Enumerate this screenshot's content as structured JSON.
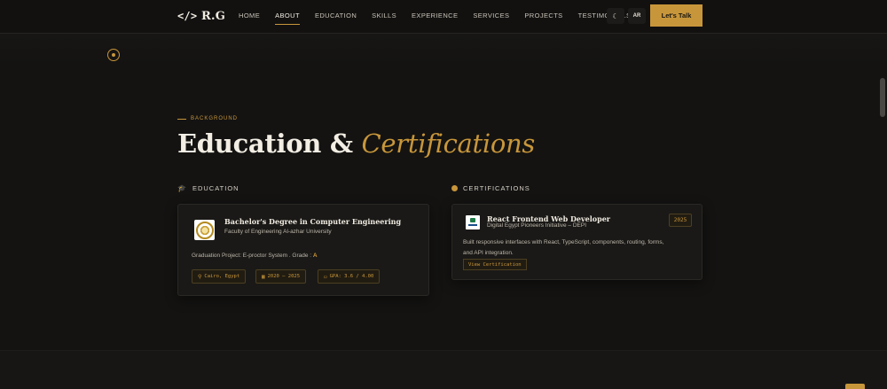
{
  "nav": {
    "logo_code": "</>",
    "logo_text": "R.G",
    "links": [
      {
        "label": "HOME",
        "active": false
      },
      {
        "label": "ABOUT",
        "active": true
      },
      {
        "label": "EDUCATION",
        "active": false
      },
      {
        "label": "SKILLS",
        "active": false
      },
      {
        "label": "EXPERIENCE",
        "active": false
      },
      {
        "label": "SERVICES",
        "active": false
      },
      {
        "label": "PROJECTS",
        "active": false
      },
      {
        "label": "TESTIMONIALS",
        "active": false
      }
    ],
    "theme_icon": "moon-icon",
    "lang_label": "AR",
    "cta_label": "Let's Talk"
  },
  "section": {
    "eyebrow": "BACKGROUND",
    "title_main": "Education",
    "title_amp": " & ",
    "title_accent": "Certifications"
  },
  "education": {
    "heading": "EDUCATION",
    "heading_icon": "graduation-cap-icon",
    "card": {
      "title": "Bachelor's Degree in Computer Engineering",
      "subtitle": "Faculty of Engineering Al-azhar University",
      "project_label": "Graduation Project: E-proctor System . Grade : ",
      "grade": "A",
      "chips": [
        {
          "icon": "location-pin-icon",
          "text": "Cairo, Egypt"
        },
        {
          "icon": "calendar-icon",
          "text": "2020 – 2025"
        },
        {
          "icon": "document-icon",
          "text": "GPA: 3.6 / 4.00"
        }
      ]
    }
  },
  "certifications": {
    "heading": "CERTIFICATIONS",
    "card": {
      "title": "React Frontend Web Developer",
      "subtitle": "Digital Egypt Pioneers Initiative – DEPI",
      "year": "2025",
      "description_line1": "Built responsive interfaces with React, TypeScript, components, routing, forms,",
      "description_line2": "and API integration.",
      "button_label": "View Certification"
    }
  },
  "colors": {
    "accent": "#c8963a",
    "background": "#141312",
    "card": "#1a1917"
  }
}
